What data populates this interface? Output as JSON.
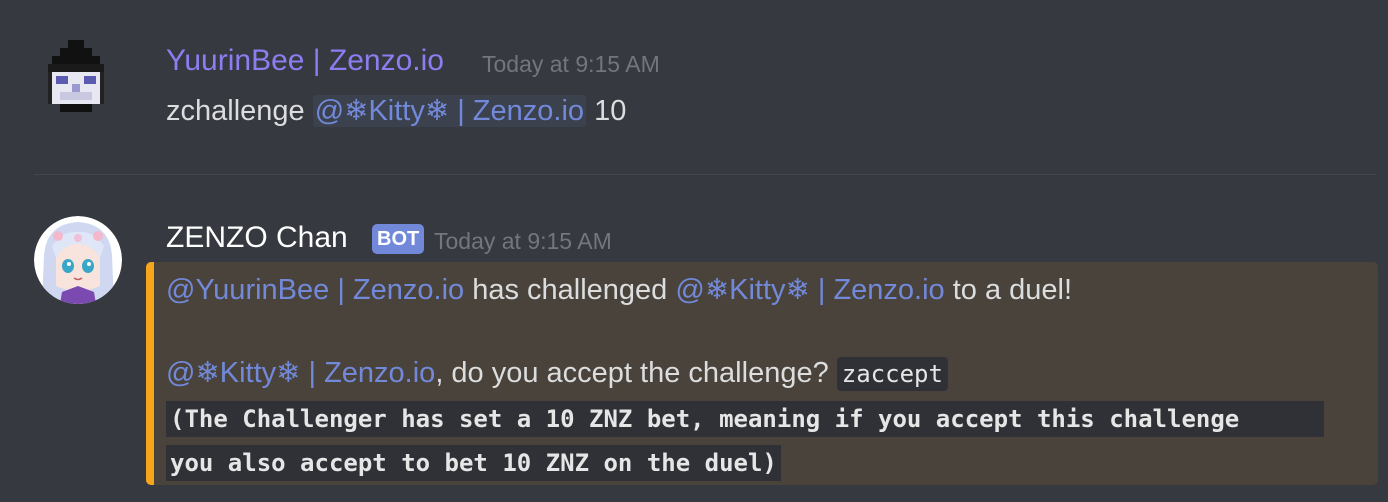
{
  "messages": [
    {
      "author": "YuurinBee | Zenzo.io",
      "author_color": "#8c7ef0",
      "timestamp": "Today at 9:15 AM",
      "text_prefix": "zchallenge ",
      "mention": "@❄Kitty❄ | Zenzo.io",
      "text_suffix": " 10"
    },
    {
      "author": "ZENZO Chan",
      "author_color": "#ffffff",
      "bot_tag": "BOT",
      "timestamp": "Today at 9:15 AM",
      "embed": {
        "accent_color": "#f7a51a",
        "line1": {
          "mention_a": "@YuurinBee | Zenzo.io",
          "middle": " has challenged ",
          "mention_b": "@❄Kitty❄ | Zenzo.io",
          "end": " to a duel!"
        },
        "line2": {
          "mention": "@❄Kitty❄ | Zenzo.io",
          "text": ", do you accept the challenge? ",
          "code": "zaccept"
        },
        "code_line1": "(The Challenger has set a 10 ZNZ bet, meaning if you accept this challenge",
        "code_line2": "you also accept to bet 10 ZNZ on the duel)"
      }
    }
  ]
}
